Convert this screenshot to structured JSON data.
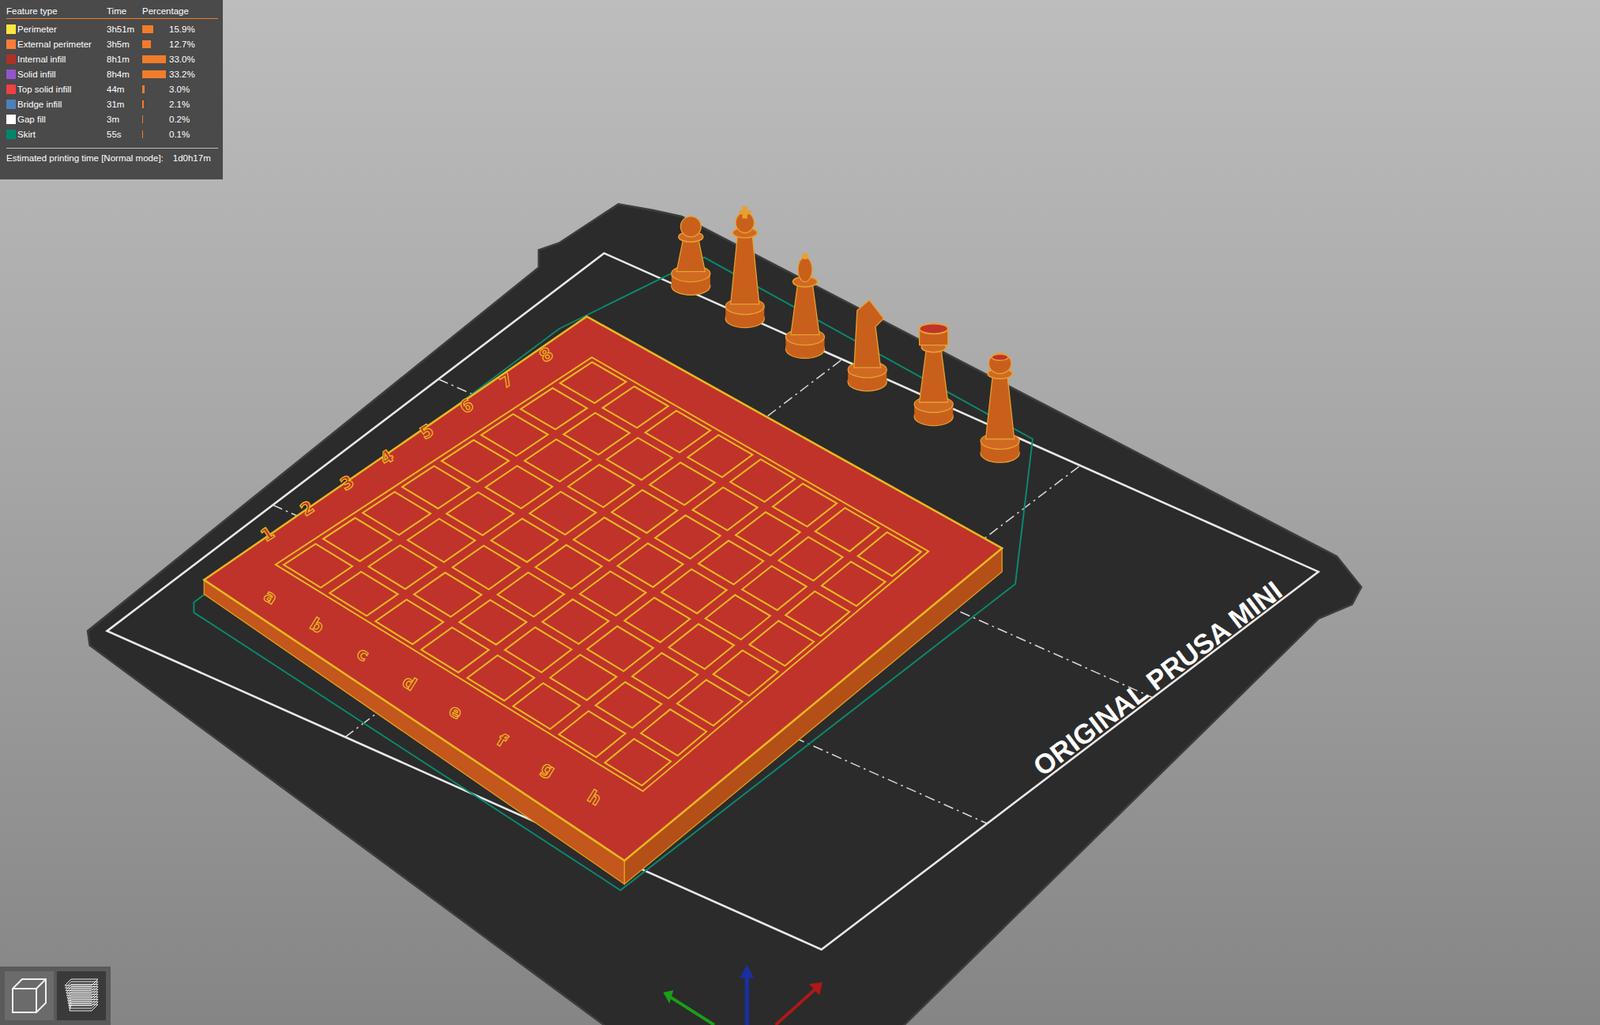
{
  "legend": {
    "columns": [
      "Feature type",
      "Time",
      "Percentage"
    ],
    "rows": [
      {
        "name": "Perimeter",
        "time": "3h51m",
        "percentage": "15.9%",
        "color": "#ffe640",
        "level": 0.48
      },
      {
        "name": "External perimeter",
        "time": "3h5m",
        "percentage": "12.7%",
        "color": "#ff7d38",
        "level": 0.38
      },
      {
        "name": "Internal infill",
        "time": "8h1m",
        "percentage": "33.0%",
        "color": "#b03029",
        "level": 0.99
      },
      {
        "name": "Solid infill",
        "time": "8h4m",
        "percentage": "33.2%",
        "color": "#9654cc",
        "level": 1.0
      },
      {
        "name": "Top solid infill",
        "time": "44m",
        "percentage": "3.0%",
        "color": "#f04040",
        "level": 0.09
      },
      {
        "name": "Bridge infill",
        "time": "31m",
        "percentage": "2.1%",
        "color": "#4d80ba",
        "level": 0.06
      },
      {
        "name": "Gap fill",
        "time": "3m",
        "percentage": "0.2%",
        "color": "#ffffff",
        "level": 0.01
      },
      {
        "name": "Skirt",
        "time": "55s",
        "percentage": "0.1%",
        "color": "#00876e",
        "level": 0.01
      }
    ],
    "estimate_label": "Estimated printing time [Normal mode]:",
    "estimate": "1d0h17m"
  },
  "bed": {
    "label": "ORIGINAL PRUSA MINI"
  },
  "board": {
    "ranks": [
      "1",
      "2",
      "3",
      "4",
      "5",
      "6",
      "7",
      "8"
    ],
    "files": [
      "a",
      "b",
      "c",
      "d",
      "e",
      "f",
      "g",
      "h"
    ]
  },
  "view_buttons": [
    {
      "kind": "cube",
      "selected": false
    },
    {
      "kind": "layers",
      "selected": true
    }
  ]
}
